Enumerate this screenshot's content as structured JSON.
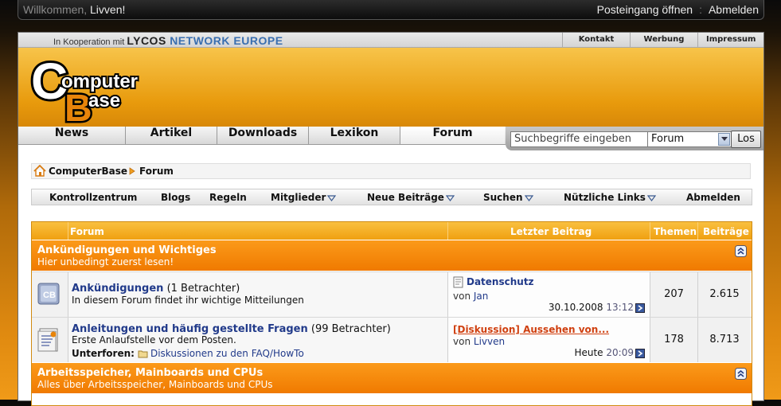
{
  "topbar": {
    "welcome_prefix": "Willkommen,",
    "username": "Livven!",
    "inbox_link": "Posteingang öffnen",
    "logout_link": "Abmelden"
  },
  "partner": {
    "prefix": "In Kooperation mit",
    "logo_text_1": "LYCOS",
    "logo_text_2": "NETWORK EUROPE",
    "links": [
      "Kontakt",
      "Werbung",
      "Impressum"
    ]
  },
  "logo": {
    "line1": "omputer",
    "line2": "ase",
    "c": "C",
    "b": "B"
  },
  "nav": {
    "items": [
      "News",
      "Artikel",
      "Downloads",
      "Lexikon",
      "Forum"
    ],
    "active": "Forum"
  },
  "search": {
    "placeholder": "Suchbegriffe eingeben",
    "scope": "Forum",
    "button": "Los"
  },
  "breadcrumb": {
    "items": [
      "ComputerBase",
      "Forum"
    ]
  },
  "subnav": {
    "items": [
      "Kontrollzentrum",
      "Blogs",
      "Regeln",
      "Mitglieder",
      "Neue Beiträge",
      "Suchen",
      "Nützliche Links",
      "Abmelden"
    ]
  },
  "table": {
    "headers": {
      "forum": "Forum",
      "last_post": "Letzter Beitrag",
      "threads": "Themen",
      "posts": "Beiträge"
    }
  },
  "categories": [
    {
      "title": "Ankündigungen und Wichtiges",
      "subtitle": "Hier unbedingt zuerst lesen!"
    },
    {
      "title": "Arbeitsspeicher, Mainboards und CPUs",
      "subtitle": "Alles über Arbeitsspeicher, Mainboards und CPUs"
    }
  ],
  "forums": [
    {
      "title": "Ankündigungen",
      "viewers": "(1 Betrachter)",
      "description": "In diesem Forum findet ihr wichtige Mitteilungen",
      "last_title": "Datenschutz",
      "last_by_prefix": "von",
      "last_by": "Jan",
      "last_date": "30.10.2008",
      "last_time": "13:12",
      "threads": "207",
      "posts": "2.615"
    },
    {
      "title": "Anleitungen und häufig gestellte Fragen",
      "viewers": "(99 Betrachter)",
      "description": "Erste Anlaufstelle vor dem Posten.",
      "subforums_label": "Unterforen:",
      "subforum": "Diskussionen zu den FAQ/HowTo",
      "last_title": "[Diskussion] Aussehen von...",
      "last_by_prefix": "von",
      "last_by": "Livven",
      "last_date": "Heute",
      "last_time": "20:09",
      "threads": "178",
      "posts": "8.713"
    }
  ],
  "colors": {
    "accent": "#f07a00",
    "link": "#213a8a",
    "new_post": "#d04010"
  }
}
